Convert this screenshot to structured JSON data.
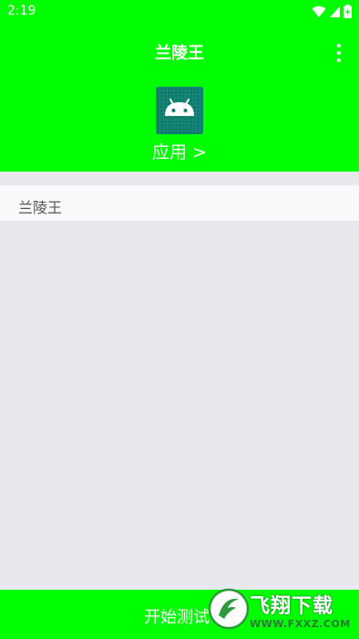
{
  "status_bar": {
    "time": "2:19",
    "icons": [
      "wifi-icon",
      "signal-icon",
      "battery-icon"
    ]
  },
  "toolbar": {
    "title": "兰陵王",
    "menu_icon": "more-vert-icon"
  },
  "app_selector": {
    "label": "应用 >",
    "icon": "android-icon"
  },
  "list": {
    "items": [
      {
        "label": "兰陵王"
      }
    ]
  },
  "bottom_button": {
    "label": "开始测试"
  },
  "watermark": {
    "text": "飞翔下载",
    "url": "WWW.FXXZ.COM"
  },
  "colors": {
    "accent": "#00ff00",
    "background": "#e8e9ef",
    "icon_bg": "#0f7a6e"
  }
}
